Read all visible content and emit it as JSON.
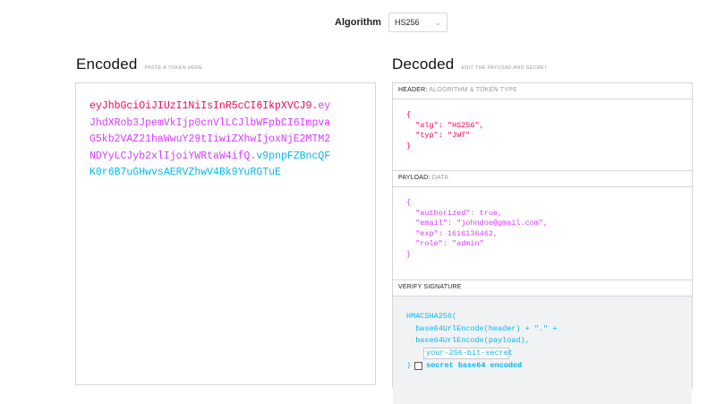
{
  "algorithm": {
    "label": "Algorithm",
    "selected": "HS256"
  },
  "encoded": {
    "title": "Encoded",
    "hint": "PASTE A TOKEN HERE",
    "lines": [
      [
        {
          "t": "eyJhbGciOiJIUzI1NiIsInR5cCI6IkpXVCJ9",
          "c": "header"
        },
        {
          "t": ".",
          "c": "header"
        },
        {
          "t": "ey",
          "c": "payload"
        }
      ],
      [
        {
          "t": "JhdXRob3JpemVkIjp0cnVlLCJlbWFpbCI6Impva",
          "c": "payload"
        }
      ],
      [
        {
          "t": "G5kb2VAZ21haWwuY29tIiwiZXhwIjoxNjE2MTM2",
          "c": "payload"
        }
      ],
      [
        {
          "t": "NDYyLCJyb2xlIjoiYWRtaW4ifQ",
          "c": "payload"
        },
        {
          "t": ".",
          "c": "payload"
        },
        {
          "t": "v9pnpFZBncQF",
          "c": "sig"
        }
      ],
      [
        {
          "t": "K0r6B7uGHwvsAERVZhwV4Bk9YuRGTuE",
          "c": "sig"
        }
      ]
    ]
  },
  "decoded": {
    "title": "Decoded",
    "hint": "EDIT THE PAYLOAD AND SECRET",
    "header_section": {
      "label": "HEADER:",
      "sub": "ALGORITHM & TOKEN TYPE",
      "lines": [
        "{",
        "  \"alg\": \"HS256\",",
        "  \"typ\": \"JWT\"",
        "}"
      ]
    },
    "payload_section": {
      "label": "PAYLOAD:",
      "sub": "DATA",
      "lines": [
        "{",
        "  \"authorized\": true,",
        "  \"email\": \"johndoe@gmail.com\",",
        "  \"exp\": 1616136462,",
        "  \"role\": \"admin\"",
        "}"
      ]
    },
    "signature_section": {
      "label": "VERIFY SIGNATURE",
      "line1": "HMACSHA256(",
      "line2": "  base64UrlEncode(header) + \".\" +",
      "line3": "  base64UrlEncode(payload),",
      "secret_value": "your-256-bit-secret",
      "close": ")",
      "checkbox_label": "secret base64 encoded"
    }
  },
  "colors": {
    "header": "#fb015b",
    "payload": "#d63aff",
    "signature": "#00b9f1"
  }
}
